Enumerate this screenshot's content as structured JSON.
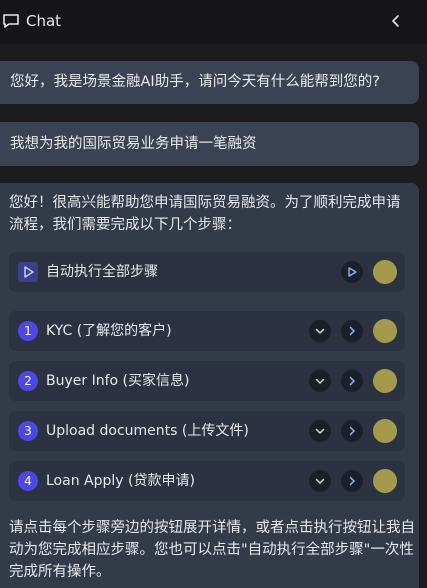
{
  "header": {
    "title": "Chat"
  },
  "messages": {
    "assistant_greeting": "您好，我是场景金融AI助手，请问今天有什么能帮到您的?",
    "user_request": "我想为我的国际贸易业务申请一笔融资",
    "assistant_intro": "您好！很高兴能帮助您申请国际贸易融资。为了顺利完成申请流程，我们需要完成以下几个步骤：",
    "assistant_outro": "请点击每个步骤旁边的按钮展开详情，或者点击执行按钮让我自动为您完成相应步骤。您也可以点击\"自动执行全部步骤\"一次性完成所有操作。"
  },
  "auto_run": {
    "label": "自动执行全部步骤"
  },
  "steps": [
    {
      "num": "1",
      "label": "KYC (了解您的客户)"
    },
    {
      "num": "2",
      "label": "Buyer Info (买家信息)"
    },
    {
      "num": "3",
      "label": "Upload documents (上传文件)"
    },
    {
      "num": "4",
      "label": "Loan Apply (贷款申请)"
    }
  ],
  "icons": {
    "header": "chat-bubble-icon",
    "back": "chevron-left-icon",
    "expand": "chevron-down-icon",
    "execute": "chevron-right-icon",
    "run": "play-icon"
  },
  "colors": {
    "accent": "#4f46e5",
    "bubble": "#3a4253",
    "panel": "#333a48",
    "step_bg": "#2c3241",
    "avatar": "#a49a4b"
  }
}
